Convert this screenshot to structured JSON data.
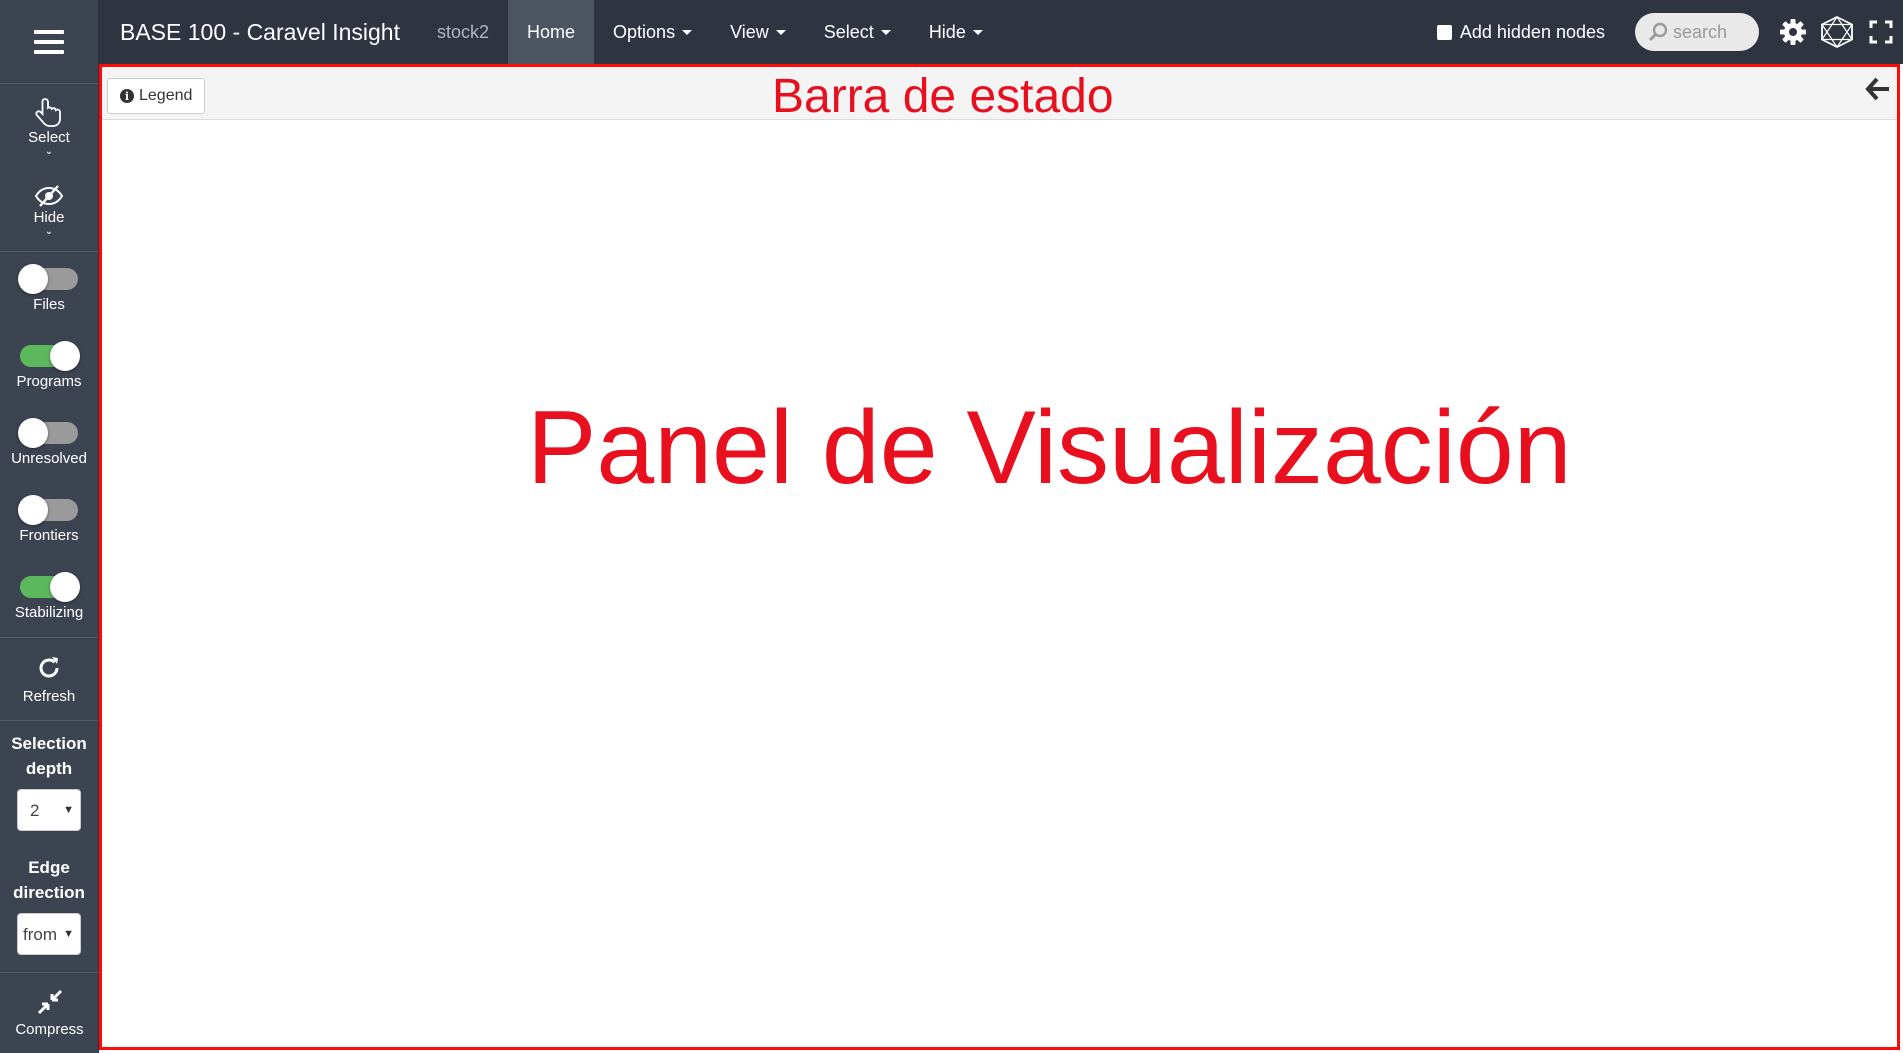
{
  "navbar": {
    "brand": "BASE 100 - Caravel Insight",
    "project": "stock2",
    "menu": [
      {
        "label": "Home",
        "active": true,
        "dropdown": false
      },
      {
        "label": "Options",
        "dropdown": true
      },
      {
        "label": "View",
        "dropdown": true
      },
      {
        "label": "Select",
        "dropdown": true
      },
      {
        "label": "Hide",
        "dropdown": true
      }
    ],
    "add_hidden_nodes_label": "Add hidden nodes",
    "add_hidden_nodes_checked": false,
    "search_placeholder": "search",
    "icons": [
      "gear-icon",
      "network-icon",
      "fullscreen-icon"
    ]
  },
  "sidebar": {
    "menu_icon": "hamburger-icon",
    "select_label": "Select",
    "hide_label": "Hide",
    "toggles": [
      {
        "label": "Files",
        "on": false
      },
      {
        "label": "Programs",
        "on": true
      },
      {
        "label": "Unresolved",
        "on": false
      },
      {
        "label": "Frontiers",
        "on": false
      },
      {
        "label": "Stabilizing",
        "on": true
      }
    ],
    "refresh_label": "Refresh",
    "selection_depth_label_1": "Selection",
    "selection_depth_label_2": "depth",
    "selection_depth_value": "2",
    "edge_direction_label_1": "Edge",
    "edge_direction_label_2": "direction",
    "edge_direction_value": "from",
    "compress_label": "Compress"
  },
  "statusbar": {
    "legend_label": "Legend",
    "annotation": "Barra de estado"
  },
  "panel": {
    "annotation": "Panel de Visualización"
  },
  "colors": {
    "annotation_red": "#e8101e",
    "sidebar_bg": "#3d4451",
    "navbar_bg": "#2e3440",
    "toggle_on": "#5cb85c"
  }
}
